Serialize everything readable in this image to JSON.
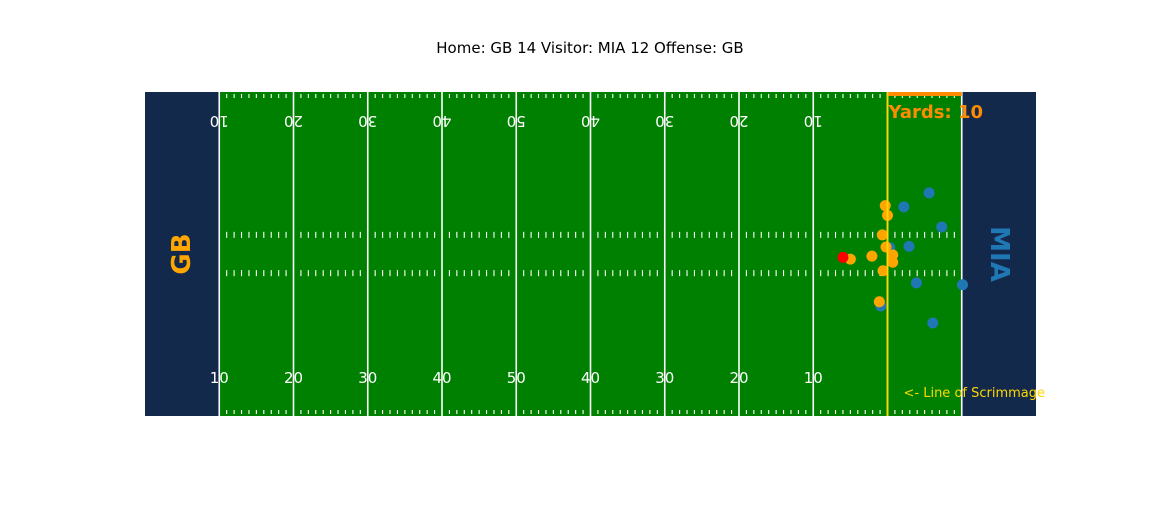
{
  "chart_data": {
    "type": "scatter",
    "title": "Home: GB 14   Visitor: MIA 12   Offense: GB",
    "home_team": "GB",
    "visitor_team": "MIA",
    "home_score": 14,
    "visitor_score": 12,
    "offense": "GB",
    "colors": {
      "field": "#008000",
      "endzone": "#13294B",
      "home_endzone_text": "#FFA500",
      "visitor_endzone_text": "#1F77B4",
      "offense_players": "#FFA500",
      "defense_players": "#1F77B4",
      "football": "#FF0000",
      "line_of_scrimmage": "#FFD700",
      "first_down_marker": "#FF8C00",
      "yard_lines": "#FFFFFF"
    },
    "x_range": [
      0,
      120
    ],
    "y_range": [
      0,
      53.3
    ],
    "yard_number_positions": [
      10,
      20,
      30,
      40,
      50,
      60,
      70,
      80,
      90
    ],
    "yard_number_labels": [
      "10",
      "20",
      "30",
      "40",
      "50",
      "40",
      "30",
      "20",
      "10"
    ],
    "line_of_scrimmage_x": 100,
    "line_of_scrimmage_label": "<- Line of Scrimmage",
    "first_down_x": 110,
    "yards_to_go": 10,
    "yards_label": "Yards: 10",
    "offense_players": [
      {
        "x": 99.7,
        "y": 34.6
      },
      {
        "x": 100.0,
        "y": 33.0
      },
      {
        "x": 99.3,
        "y": 29.8
      },
      {
        "x": 99.8,
        "y": 27.8
      },
      {
        "x": 100.7,
        "y": 26.5
      },
      {
        "x": 100.7,
        "y": 25.3
      },
      {
        "x": 97.9,
        "y": 26.3
      },
      {
        "x": 95.0,
        "y": 25.8
      },
      {
        "x": 99.4,
        "y": 23.9
      },
      {
        "x": 98.9,
        "y": 18.8
      }
    ],
    "defense_players": [
      {
        "x": 102.2,
        "y": 34.4
      },
      {
        "x": 105.6,
        "y": 36.7
      },
      {
        "x": 107.3,
        "y": 31.1
      },
      {
        "x": 102.9,
        "y": 27.9
      },
      {
        "x": 100.3,
        "y": 27.7
      },
      {
        "x": 103.9,
        "y": 21.9
      },
      {
        "x": 110.1,
        "y": 21.6
      },
      {
        "x": 106.1,
        "y": 15.3
      },
      {
        "x": 99.1,
        "y": 18.1
      }
    ],
    "football": {
      "x": 94.0,
      "y": 26.1
    }
  }
}
